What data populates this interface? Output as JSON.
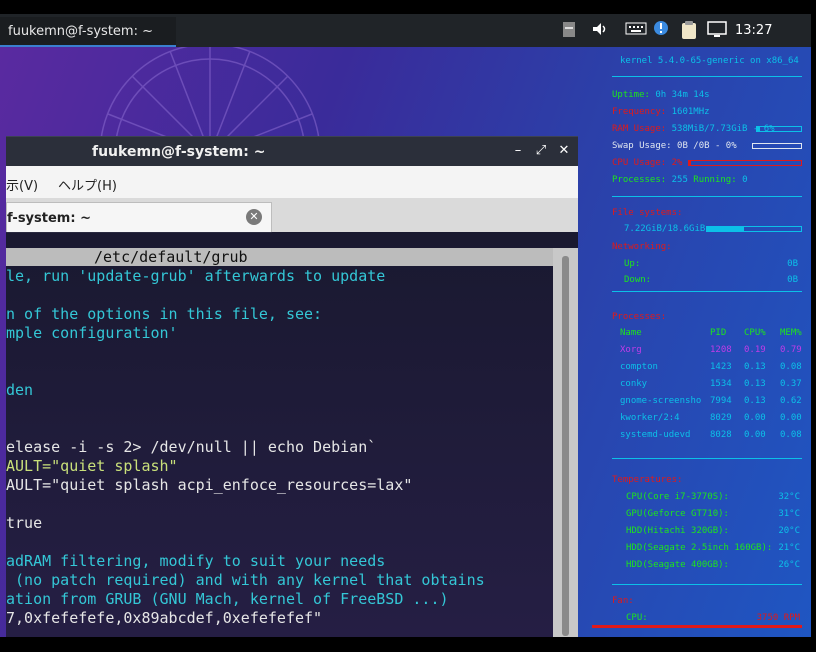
{
  "panel": {
    "task_title": "fuukemn@f-system: ~",
    "clock": "13:27"
  },
  "window": {
    "title": "fuukemn@f-system: ~",
    "minimize": "–",
    "maximize": "⤢",
    "close": "✕",
    "menu_view": "示(V)",
    "menu_help": "ヘルプ(H)",
    "tab_label": "f-system: ~",
    "tab_close": "✕"
  },
  "editor": {
    "header": "/etc/default/grub",
    "lines": [
      {
        "text": "le, run 'update-grub' afterwards to update",
        "color": "cyan"
      },
      {
        "text": "",
        "color": "cyan"
      },
      {
        "text": "n of the options in this file, see:",
        "color": "cyan"
      },
      {
        "text": "mple configuration'",
        "color": "cyan"
      },
      {
        "text": "",
        "color": "cyan"
      },
      {
        "text": "",
        "color": "cyan"
      },
      {
        "text": "den",
        "color": "cyan"
      },
      {
        "text": "",
        "color": "cyan"
      },
      {
        "text": "",
        "color": "cyan"
      },
      {
        "text": "elease -i -s 2> /dev/null || echo Debian`",
        "color": "white"
      },
      {
        "text": "AULT=\"quiet splash\"",
        "color": "green"
      },
      {
        "text": "AULT=\"quiet splash acpi_enfoce_resources=lax\"",
        "color": "white"
      },
      {
        "text": "",
        "color": "white"
      },
      {
        "text": "true",
        "color": "white"
      },
      {
        "text": "",
        "color": "white"
      },
      {
        "text": "adRAM filtering, modify to suit your needs",
        "color": "cyan"
      },
      {
        "text": " (no patch required) and with any kernel that obtains",
        "color": "cyan"
      },
      {
        "text": "ation from GRUB (GNU Mach, kernel of FreeBSD ...)",
        "color": "cyan"
      },
      {
        "text": "7,0xfefefefe,0x89abcdef,0xefefefef\"",
        "color": "white"
      }
    ]
  },
  "conky": {
    "kernel": "kernel 5.4.0-65-generic on x86_64",
    "uptime_label": "Uptime:",
    "uptime": "0h 34m 14s",
    "freq_label": "Frequency:",
    "freq": "1601MHz",
    "ram_label": "RAM Usage:",
    "ram": "538MiB/7.73GiB - 6%",
    "ram_pct": 6,
    "swap_label": "Swap Usage:",
    "swap": "0B  /0B   - 0%",
    "swap_pct": 0,
    "cpu_label": "CPU Usage:",
    "cpu": "2%",
    "cpu_pct": 2,
    "proc_label": "Processes:",
    "proc": "255",
    "running_label": "Running:",
    "running": "0",
    "fs_head": "File systems:",
    "fs_value": "7.22GiB/18.6GiB",
    "fs_pct": 39,
    "net_head": "Networking:",
    "up_label": "Up:",
    "up": "0B",
    "down_label": "Down:",
    "down": "0B",
    "proc_head": "Processes:",
    "proc_cols": [
      "Name",
      "PID",
      "CPU%",
      "MEM%"
    ],
    "processes": [
      {
        "name": "Xorg",
        "pid": "1208",
        "cpu": "0.19",
        "mem": "0.79",
        "color": "m"
      },
      {
        "name": "compton",
        "pid": "1423",
        "cpu": "0.13",
        "mem": "0.08",
        "color": "b"
      },
      {
        "name": "conky",
        "pid": "1534",
        "cpu": "0.13",
        "mem": "0.37",
        "color": "b"
      },
      {
        "name": "gnome-screensho",
        "pid": "7994",
        "cpu": "0.13",
        "mem": "0.62",
        "color": "b"
      },
      {
        "name": "kworker/2:4",
        "pid": "8029",
        "cpu": "0.00",
        "mem": "0.00",
        "color": "b"
      },
      {
        "name": "systemd-udevd",
        "pid": "8028",
        "cpu": "0.00",
        "mem": "0.08",
        "color": "b"
      }
    ],
    "temp_head": "Temperatures:",
    "temps": [
      {
        "name": "CPU(Core i7-3770S):",
        "value": "32°C"
      },
      {
        "name": "GPU(Geforce GT710):",
        "value": "31°C"
      },
      {
        "name": "HDD(Hitachi 320GB):",
        "value": "20°C"
      },
      {
        "name": "HDD(Seagate 2.5inch 160GB):",
        "value": "21°C"
      },
      {
        "name": "HDD(Seagate 400GB):",
        "value": "26°C"
      }
    ],
    "fan_head": "Fan:",
    "fan_label": "CPU:",
    "fan": "3750 RPM"
  }
}
